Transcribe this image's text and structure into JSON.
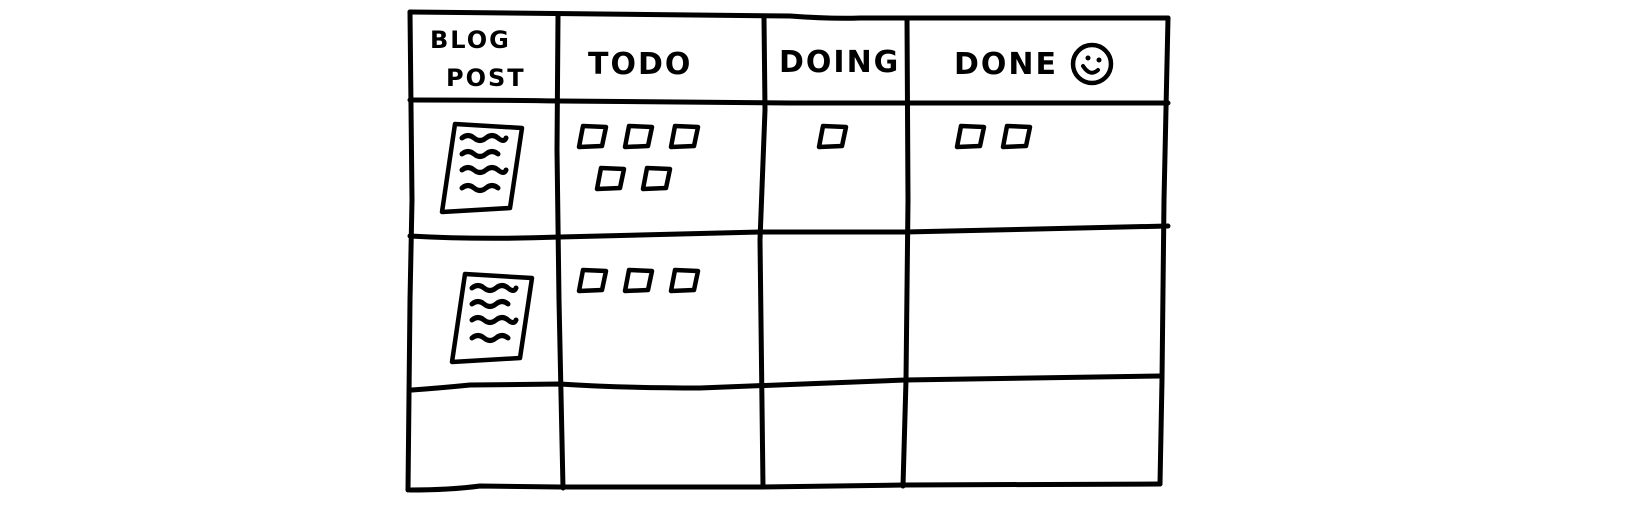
{
  "board": {
    "row_header_label_line1": "BLOG",
    "row_header_label_line2": "POST",
    "columns": [
      {
        "key": "todo",
        "label": "TODO"
      },
      {
        "key": "doing",
        "label": "DOING"
      },
      {
        "key": "done",
        "label": "DONE",
        "icon": "smiley-face-icon"
      }
    ],
    "rows": [
      {
        "item_icon": "document-icon",
        "cards": {
          "todo": 5,
          "doing": 1,
          "done": 2
        }
      },
      {
        "item_icon": "document-icon",
        "cards": {
          "todo": 3,
          "doing": 0,
          "done": 0
        }
      },
      {
        "item_icon": null,
        "cards": {
          "todo": 0,
          "doing": 0,
          "done": 0
        }
      }
    ],
    "colors": {
      "ink": "#000000",
      "paper": "#ffffff"
    }
  }
}
